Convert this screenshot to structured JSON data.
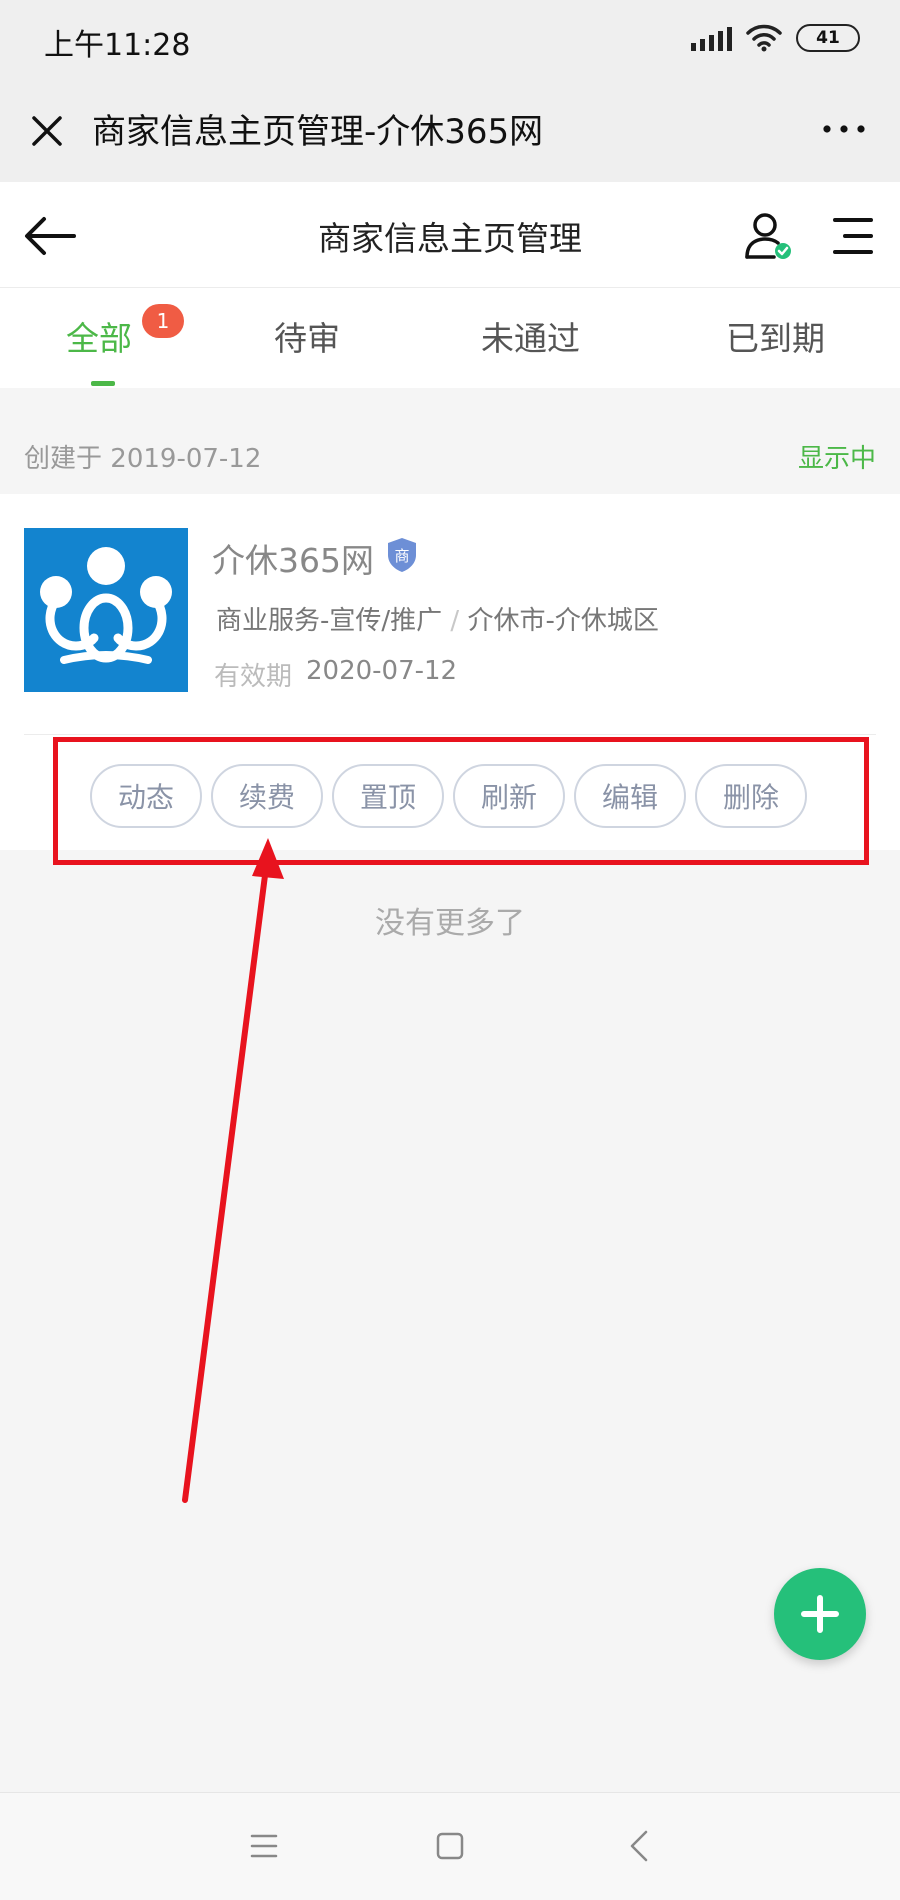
{
  "status_bar": {
    "time": "上午11:28",
    "battery": "41",
    "icons": [
      "signal-icon",
      "wifi-icon",
      "battery-icon"
    ]
  },
  "browser": {
    "title": "商家信息主页管理-介休365网",
    "close_icon": "close-icon",
    "more_icon": "more-icon"
  },
  "header": {
    "title": "商家信息主页管理",
    "back_icon": "back-arrow-icon",
    "user_icon": "user-verified-icon",
    "menu_icon": "menu-icon"
  },
  "tabs": [
    {
      "label": "全部",
      "badge": "1",
      "active": true
    },
    {
      "label": "待审"
    },
    {
      "label": "未通过"
    },
    {
      "label": "已到期"
    }
  ],
  "listing": {
    "created_label": "创建于",
    "created_date": "2019-07-12",
    "status": "显示中",
    "name": "介休365网",
    "verify_badge": "商",
    "category": "商业服务-宣传/推广",
    "separator": "/",
    "location": "介休市-介休城区",
    "validity_label": "有效期",
    "validity_date": "2020-07-12",
    "actions": [
      "动态",
      "续费",
      "置顶",
      "刷新",
      "编辑",
      "删除"
    ]
  },
  "footer": {
    "no_more": "没有更多了"
  },
  "colors": {
    "accent_green": "#4cb848",
    "badge_red": "#f05c44",
    "fab_green": "#25c07a",
    "annotation_red": "#e8131e",
    "logo_blue": "#1384cf"
  }
}
